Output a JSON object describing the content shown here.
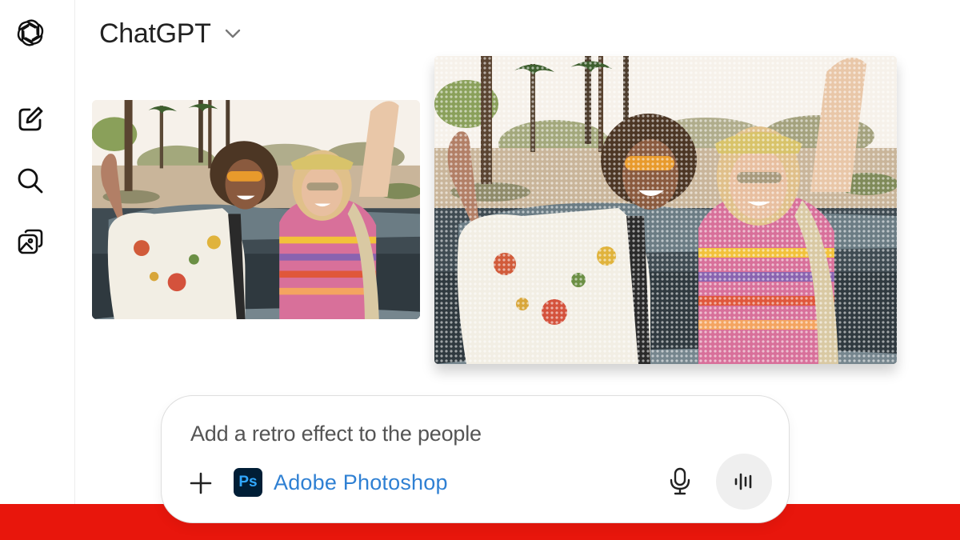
{
  "header": {
    "model_name": "ChatGPT",
    "model_chevron_icon": "chevron-down-icon"
  },
  "sidebar": {
    "items": [
      {
        "id": "logo",
        "icon": "openai-logo-icon"
      },
      {
        "id": "new-chat",
        "icon": "pencil-square-icon"
      },
      {
        "id": "search",
        "icon": "search-icon"
      },
      {
        "id": "library",
        "icon": "image-gallery-icon"
      }
    ]
  },
  "conversation": {
    "images": [
      {
        "id": "original",
        "style": "photo"
      },
      {
        "id": "retro",
        "style": "halftone retro"
      }
    ]
  },
  "composer": {
    "prompt_text": "Add a retro effect to the people",
    "add_icon": "plus-icon",
    "app": {
      "logo_text": "Ps",
      "label": "Adobe Photoshop"
    },
    "mic_icon": "microphone-icon",
    "voice_icon": "voice-waveform-icon"
  },
  "colors": {
    "accent_blue": "#2f80d3",
    "photoshop_bg": "#001e36",
    "photoshop_text": "#31a8ff",
    "red_band": "#e8160c"
  }
}
